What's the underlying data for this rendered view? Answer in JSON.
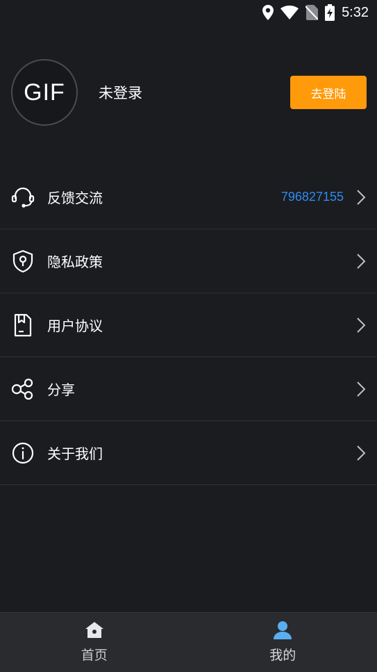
{
  "status_bar": {
    "time": "5:32",
    "icons": [
      "location-icon",
      "wifi-icon",
      "no-sim-icon",
      "battery-charging-icon"
    ]
  },
  "profile": {
    "avatar_text": "GIF",
    "name": "未登录",
    "login_label": "去登陆"
  },
  "menu": {
    "items": [
      {
        "label": "反馈交流",
        "value": "796827155",
        "icon": "headset-icon"
      },
      {
        "label": "隐私政策",
        "icon": "shield-keyhole-icon"
      },
      {
        "label": "用户协议",
        "icon": "document-icon"
      },
      {
        "label": "分享",
        "icon": "share-icon"
      },
      {
        "label": "关于我们",
        "icon": "info-icon"
      }
    ]
  },
  "tabbar": {
    "tabs": [
      {
        "label": "首页",
        "icon": "home-icon"
      },
      {
        "label": "我的",
        "icon": "user-icon",
        "active": true
      }
    ]
  },
  "colors": {
    "background": "#1b1c20",
    "accent": "#ff9a0a",
    "link": "#2d8cf0",
    "active_tab_icon": "#5aaef0"
  }
}
